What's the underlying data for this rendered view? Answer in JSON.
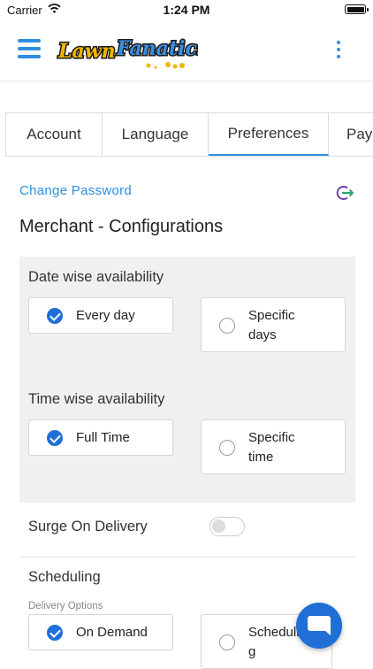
{
  "status_bar": {
    "carrier": "Carrier",
    "time": "1:24 PM"
  },
  "header": {
    "logo_alt": "Lawn Fanatics"
  },
  "tabs": [
    {
      "label": "Account",
      "active": false
    },
    {
      "label": "Language",
      "active": false
    },
    {
      "label": "Preferences",
      "active": true
    },
    {
      "label": "Pay",
      "active": false
    }
  ],
  "account": {
    "change_password": "Change Password"
  },
  "section": {
    "title": "Merchant - Configurations"
  },
  "date_wise": {
    "label": "Date wise availability",
    "options": [
      {
        "label": "Every day",
        "checked": true
      },
      {
        "label_line1": "Specific",
        "label_line2": "days",
        "checked": false
      }
    ]
  },
  "time_wise": {
    "label": "Time wise availability",
    "options": [
      {
        "label": "Full Time",
        "checked": true
      },
      {
        "label_line1": "Specific",
        "label_line2": "time",
        "checked": false
      }
    ]
  },
  "surge": {
    "label": "Surge On Delivery",
    "enabled": false
  },
  "scheduling": {
    "label": "Scheduling",
    "sublabel": "Delivery Options",
    "options": [
      {
        "label": "On Demand",
        "checked": true
      },
      {
        "label_line1": "Schedulin",
        "label_line2": "g",
        "checked": false
      }
    ]
  },
  "colors": {
    "accent": "#2d8fe0",
    "checked": "#1f6fd6",
    "panel_bg": "#f0f0f0"
  }
}
